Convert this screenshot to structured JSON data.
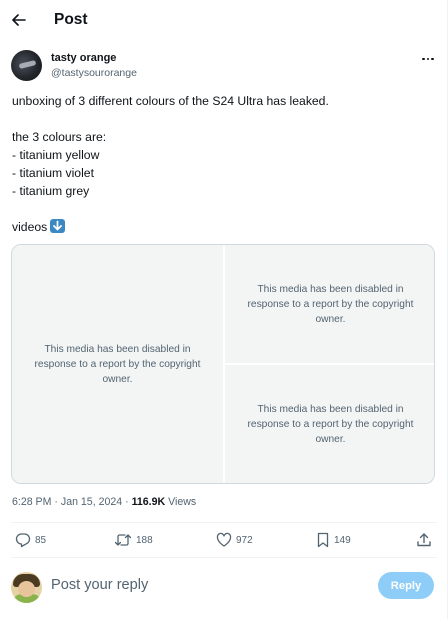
{
  "header": {
    "title": "Post"
  },
  "author": {
    "name": "tasty orange",
    "handle": "@tastysourorange"
  },
  "tweet": {
    "lines": [
      "unboxing of 3 different colours of the S24 Ultra has leaked.",
      "",
      "the 3 colours are:",
      "- titanium yellow",
      "- titanium violet",
      "- titanium grey",
      "",
      "videos"
    ],
    "emoji": "down-arrow-emoji"
  },
  "media": {
    "left_message": "This media has been disabled in response to a report by the copyright owner.",
    "top_right_message": "This media has been disabled in response to a report by the copyright owner.",
    "bottom_right_message": "This media has been disabled in response to a report by the copyright owner."
  },
  "meta": {
    "time": "6:28 PM",
    "dot": "·",
    "date": "Jan 15, 2024",
    "views_count": "116.9K",
    "views_label": "Views"
  },
  "actions": {
    "replies": "85",
    "reposts": "188",
    "likes": "972",
    "bookmarks": "149"
  },
  "reply": {
    "placeholder": "Post your reply",
    "button_label": "Reply"
  },
  "colors": {
    "accent": "#1d9bf0",
    "reply_button": "#8ecdf8",
    "muted": "#536471",
    "border": "#cfd9de"
  },
  "icons": {
    "back": "arrow-left-icon",
    "more": "more-horizontal-icon",
    "reply": "speech-bubble-icon",
    "repost": "repost-arrows-icon",
    "like": "heart-icon",
    "bookmark": "bookmark-icon",
    "share": "share-upload-icon"
  }
}
